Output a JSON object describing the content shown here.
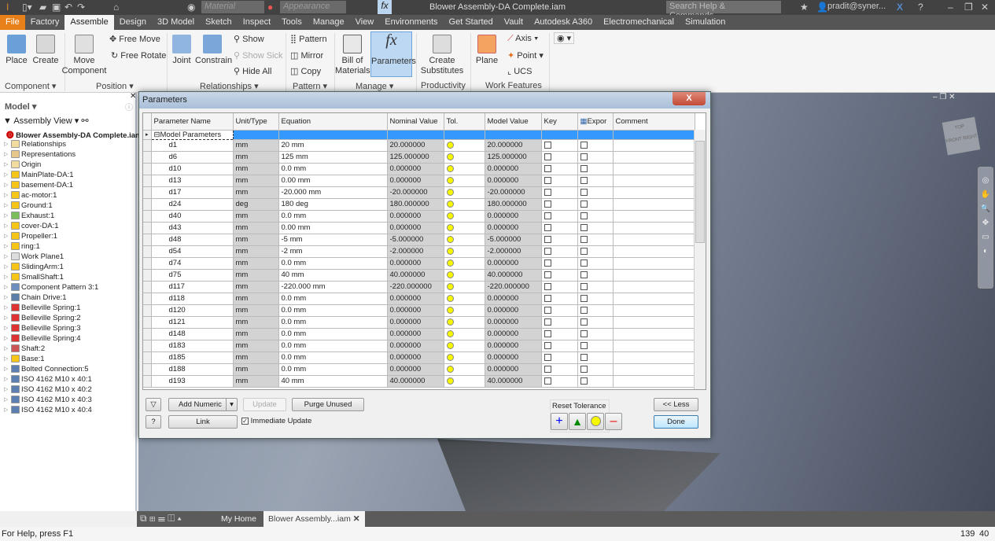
{
  "app": {
    "title": "Blower Assembly-DA Complete.iam",
    "material": "Material",
    "appearance": "Appearance",
    "search_placeholder": "Search Help & Commands...",
    "user": "pradit@syner..."
  },
  "tabs": [
    "File",
    "Factory",
    "Assemble",
    "Design",
    "3D Model",
    "Sketch",
    "Inspect",
    "Tools",
    "Manage",
    "View",
    "Environments",
    "Get Started",
    "Vault",
    "Autodesk A360",
    "Electromechanical",
    "Simulation"
  ],
  "ribbon": {
    "place": "Place",
    "create": "Create",
    "move_component": "Move Component",
    "free_move": "Free Move",
    "free_rotate": "Free Rotate",
    "joint": "Joint",
    "constrain": "Constrain",
    "show": "Show",
    "show_sick": "Show Sick",
    "hide_all": "Hide All",
    "pattern": "Pattern",
    "mirror": "Mirror",
    "copy": "Copy",
    "bom": "Bill of Materials",
    "parameters": "Parameters",
    "create_substitutes": "Create Substitutes",
    "plane": "Plane",
    "axis": "Axis",
    "point": "Point",
    "ucs": "UCS",
    "panels": [
      "Component",
      "Position",
      "Relationships",
      "Pattern",
      "Manage",
      "Productivity",
      "Work Features"
    ]
  },
  "browser": {
    "header": "Model",
    "view": "Assembly View",
    "root": "Blower Assembly-DA Complete.iam",
    "items": [
      {
        "label": "Relationships",
        "icon": "folder-icon"
      },
      {
        "label": "Representations",
        "icon": "representations-icon"
      },
      {
        "label": "Origin",
        "icon": "folder-icon"
      },
      {
        "label": "MainPlate-DA:1",
        "icon": "part-icon"
      },
      {
        "label": "basement-DA:1",
        "icon": "part-icon"
      },
      {
        "label": "ac-motor:1",
        "icon": "part-icon"
      },
      {
        "label": "Ground:1",
        "icon": "part-icon"
      },
      {
        "label": "Exhaust:1",
        "icon": "assembly-icon"
      },
      {
        "label": "cover-DA:1",
        "icon": "part-icon"
      },
      {
        "label": "Propeller:1",
        "icon": "part-icon"
      },
      {
        "label": "ring:1",
        "icon": "part-icon"
      },
      {
        "label": "Work Plane1",
        "icon": "work-plane-icon"
      },
      {
        "label": "SlidingArm:1",
        "icon": "part-icon"
      },
      {
        "label": "SmallShaft:1",
        "icon": "part-icon"
      },
      {
        "label": "Component Pattern 3:1",
        "icon": "pattern-icon"
      },
      {
        "label": "Chain Drive:1",
        "icon": "chain-icon"
      },
      {
        "label": "Belleville Spring:1",
        "icon": "spring-icon"
      },
      {
        "label": "Belleville Spring:2",
        "icon": "spring-icon"
      },
      {
        "label": "Belleville Spring:3",
        "icon": "spring-icon"
      },
      {
        "label": "Belleville Spring:4",
        "icon": "spring-icon"
      },
      {
        "label": "Shaft:2",
        "icon": "shaft-icon"
      },
      {
        "label": "Base:1",
        "icon": "part-icon"
      },
      {
        "label": "Bolted Connection:5",
        "icon": "bolt-icon"
      },
      {
        "label": "ISO 4162 M10 x 40:1",
        "icon": "bolt-icon"
      },
      {
        "label": "ISO 4162 M10 x 40:2",
        "icon": "bolt-icon"
      },
      {
        "label": "ISO 4162 M10 x 40:3",
        "icon": "bolt-icon"
      },
      {
        "label": "ISO 4162 M10 x 40:4",
        "icon": "bolt-icon"
      }
    ]
  },
  "dialog": {
    "title": "Parameters",
    "close": "X",
    "columns": [
      "Parameter Name",
      "Unit/Type",
      "Equation",
      "Nominal Value",
      "Tol.",
      "Model Value",
      "Key",
      "Expor",
      "Comment"
    ],
    "group": "Model Parameters",
    "rows": [
      [
        "d1",
        "mm",
        "20 mm",
        "20.000000",
        "20.000000"
      ],
      [
        "d6",
        "mm",
        "125 mm",
        "125.000000",
        "125.000000"
      ],
      [
        "d10",
        "mm",
        "0.0 mm",
        "0.000000",
        "0.000000"
      ],
      [
        "d13",
        "mm",
        "0.00 mm",
        "0.000000",
        "0.000000"
      ],
      [
        "d17",
        "mm",
        "-20.000 mm",
        "-20.000000",
        "-20.000000"
      ],
      [
        "d24",
        "deg",
        "180 deg",
        "180.000000",
        "180.000000"
      ],
      [
        "d40",
        "mm",
        "0.0 mm",
        "0.000000",
        "0.000000"
      ],
      [
        "d43",
        "mm",
        "0.00 mm",
        "0.000000",
        "0.000000"
      ],
      [
        "d48",
        "mm",
        "-5 mm",
        "-5.000000",
        "-5.000000"
      ],
      [
        "d54",
        "mm",
        "-2 mm",
        "-2.000000",
        "-2.000000"
      ],
      [
        "d74",
        "mm",
        "0.0 mm",
        "0.000000",
        "0.000000"
      ],
      [
        "d75",
        "mm",
        "40 mm",
        "40.000000",
        "40.000000"
      ],
      [
        "d117",
        "mm",
        "-220.000 mm",
        "-220.000000",
        "-220.000000"
      ],
      [
        "d118",
        "mm",
        "0.0 mm",
        "0.000000",
        "0.000000"
      ],
      [
        "d120",
        "mm",
        "0.0 mm",
        "0.000000",
        "0.000000"
      ],
      [
        "d121",
        "mm",
        "0.0 mm",
        "0.000000",
        "0.000000"
      ],
      [
        "d148",
        "mm",
        "0.0 mm",
        "0.000000",
        "0.000000"
      ],
      [
        "d183",
        "mm",
        "0.0 mm",
        "0.000000",
        "0.000000"
      ],
      [
        "d185",
        "mm",
        "0.0 mm",
        "0.000000",
        "0.000000"
      ],
      [
        "d188",
        "mm",
        "0.0 mm",
        "0.000000",
        "0.000000"
      ],
      [
        "d193",
        "mm",
        "40 mm",
        "40.000000",
        "40.000000"
      ]
    ],
    "add_numeric": "Add Numeric",
    "update": "Update",
    "purge_unused": "Purge Unused",
    "link": "Link",
    "immediate_update": "Immediate Update",
    "immediate_update_checked": true,
    "reset_tolerance": "Reset Tolerance",
    "less": "<< Less",
    "done": "Done"
  },
  "viewcube": {
    "top": "TOP",
    "front": "FRONT",
    "right": "RIGHT"
  },
  "doc_tabs": {
    "home": "My Home",
    "doc": "Blower Assembly...iam"
  },
  "status": {
    "help": "For Help, press F1",
    "count1": "139",
    "count2": "40"
  },
  "colors": {
    "accent": "#3399ff",
    "file_tab": "#e8801a",
    "tol_dot": "#f7f700"
  }
}
